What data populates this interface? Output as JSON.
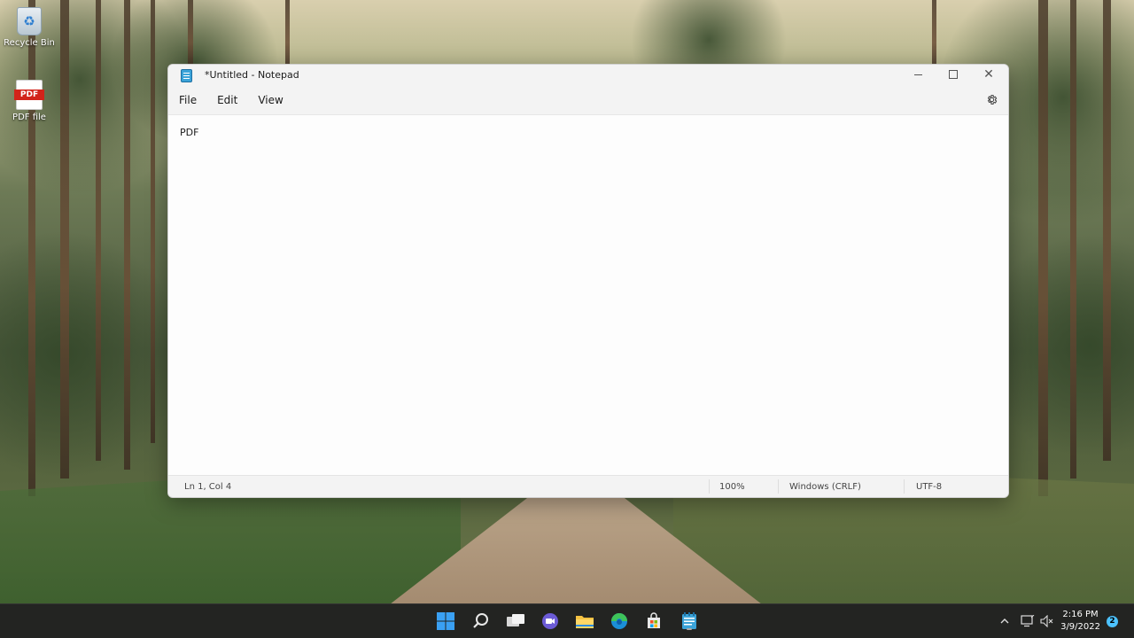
{
  "desktop": {
    "icons": [
      {
        "label": "Recycle Bin",
        "icon": "recycle-bin-icon"
      },
      {
        "label": "PDF file",
        "icon": "pdf-file-icon",
        "badge": "PDF"
      }
    ]
  },
  "notepad": {
    "title": "*Untitled - Notepad",
    "menu": [
      "File",
      "Edit",
      "View"
    ],
    "settings_icon": "gear-icon",
    "content": "PDF",
    "status": {
      "position": "Ln 1, Col 4",
      "zoom": "100%",
      "line_ending": "Windows (CRLF)",
      "encoding": "UTF-8"
    }
  },
  "taskbar": {
    "apps": [
      "start-icon",
      "search-icon",
      "task-view-icon",
      "chat-icon",
      "file-explorer-icon",
      "edge-icon",
      "store-icon",
      "notepad-icon"
    ],
    "clock": {
      "time": "2:16 PM",
      "date": "3/9/2022"
    },
    "notifications": "2"
  },
  "colors": {
    "accent": "#0078d4",
    "taskbar": "#202020",
    "window": "#fbfbfb"
  }
}
